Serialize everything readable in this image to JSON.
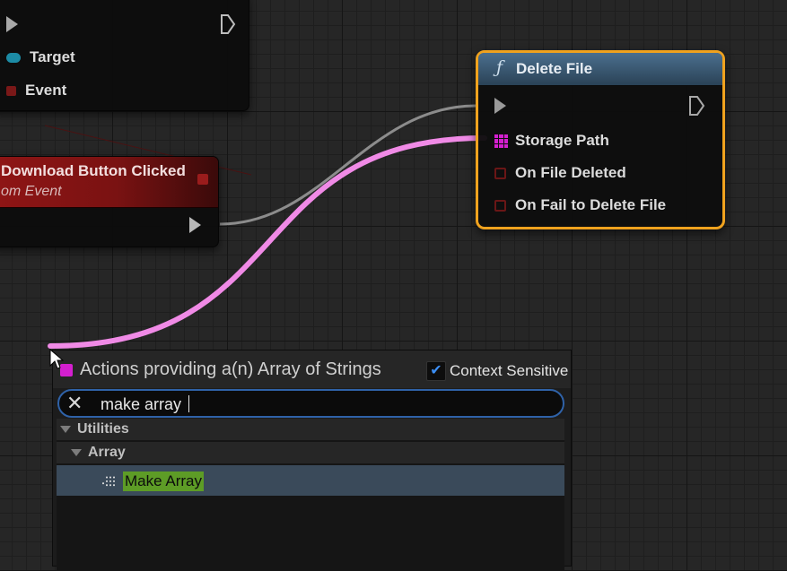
{
  "node_target_event": {
    "pins": [
      {
        "label": "Target",
        "color": "#1c8ba5"
      },
      {
        "label": "Event",
        "color": "#8a1a1a"
      }
    ]
  },
  "node_custom_event": {
    "title": "Download Button Clicked",
    "subtitle": "om Event",
    "header_color": "#8f1515"
  },
  "node_delete_file": {
    "function_icon": "ƒ",
    "title": "Delete File",
    "header_color": "#3c5a76",
    "selected_outline_color": "#f0a21e",
    "pins": [
      {
        "label": "Storage Path",
        "color": "#d41fcf"
      },
      {
        "label": "On File Deleted",
        "color": "#8a1a1a"
      },
      {
        "label": "On Fail to Delete File",
        "color": "#8a1a1a"
      }
    ]
  },
  "wires": {
    "array_wire_color": "#f08ae6",
    "exec_wire_color": "#9a9a9a"
  },
  "action_menu": {
    "title": "Actions providing a(n) Array of Strings",
    "context_sensitive_label": "Context Sensitive",
    "context_sensitive_checked": true,
    "search": {
      "value": "make array",
      "placeholder": ""
    },
    "categories": [
      {
        "label": "Utilities"
      },
      {
        "label": "Array"
      }
    ],
    "result": {
      "icon": "make-array-icon",
      "label": "Make Array",
      "highlight_color": "#5d9c26"
    }
  }
}
